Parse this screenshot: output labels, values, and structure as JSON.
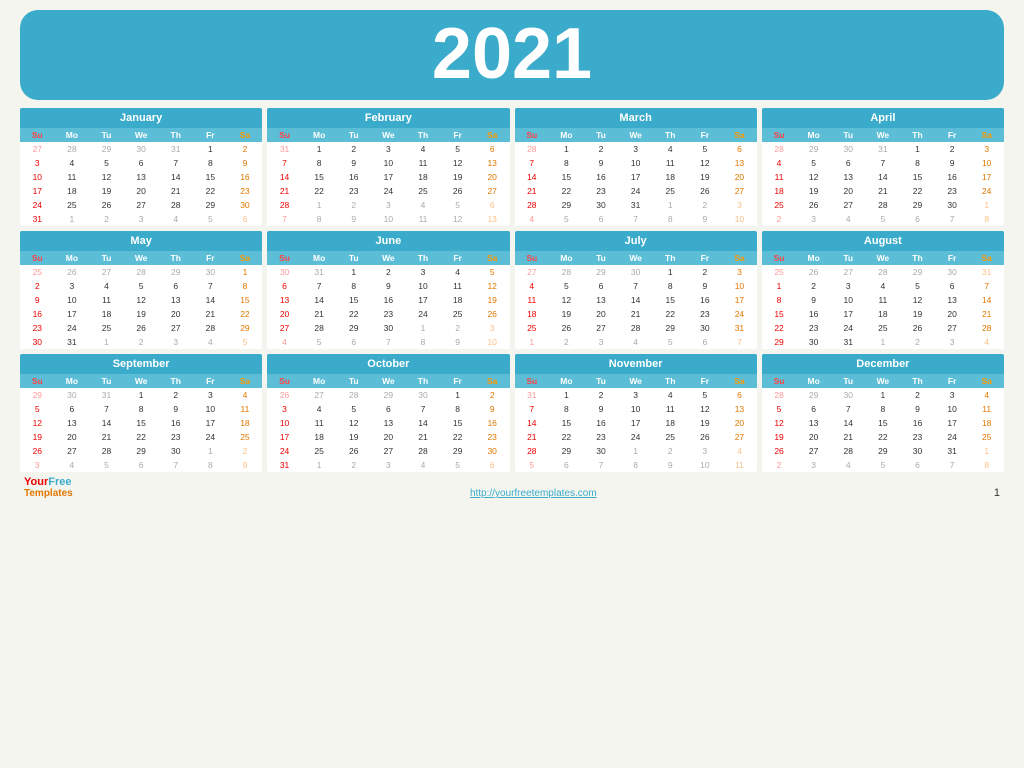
{
  "year": "2021",
  "months": [
    {
      "name": "January",
      "weeks": [
        [
          "27",
          "28",
          "29",
          "30",
          "31",
          "1",
          "2"
        ],
        [
          "3",
          "4",
          "5",
          "6",
          "7",
          "8",
          "9"
        ],
        [
          "10",
          "11",
          "12",
          "13",
          "14",
          "15",
          "16"
        ],
        [
          "17",
          "18",
          "19",
          "20",
          "21",
          "22",
          "23"
        ],
        [
          "24",
          "25",
          "26",
          "27",
          "28",
          "29",
          "30"
        ],
        [
          "31",
          "1",
          "2",
          "3",
          "4",
          "5",
          "6"
        ]
      ],
      "otherMonthCells": [
        [
          0,
          0
        ],
        [
          0,
          1
        ],
        [
          0,
          2
        ],
        [
          0,
          3
        ],
        [
          0,
          4
        ],
        [
          5,
          1
        ],
        [
          5,
          2
        ],
        [
          5,
          3
        ],
        [
          5,
          4
        ],
        [
          5,
          5
        ],
        [
          5,
          6
        ]
      ]
    },
    {
      "name": "February",
      "weeks": [
        [
          "31",
          "1",
          "2",
          "3",
          "4",
          "5",
          "6"
        ],
        [
          "7",
          "8",
          "9",
          "10",
          "11",
          "12",
          "13"
        ],
        [
          "14",
          "15",
          "16",
          "17",
          "18",
          "19",
          "20"
        ],
        [
          "21",
          "22",
          "23",
          "24",
          "25",
          "26",
          "27"
        ],
        [
          "28",
          "1",
          "2",
          "3",
          "4",
          "5",
          "6"
        ],
        [
          "7",
          "8",
          "9",
          "10",
          "11",
          "12",
          "13"
        ]
      ],
      "otherMonthCells": [
        [
          0,
          0
        ],
        [
          4,
          1
        ],
        [
          4,
          2
        ],
        [
          4,
          3
        ],
        [
          4,
          4
        ],
        [
          4,
          5
        ],
        [
          4,
          6
        ],
        [
          5,
          0
        ],
        [
          5,
          1
        ],
        [
          5,
          2
        ],
        [
          5,
          3
        ],
        [
          5,
          4
        ],
        [
          5,
          5
        ],
        [
          5,
          6
        ]
      ]
    },
    {
      "name": "March",
      "weeks": [
        [
          "28",
          "1",
          "2",
          "3",
          "4",
          "5",
          "6"
        ],
        [
          "7",
          "8",
          "9",
          "10",
          "11",
          "12",
          "13"
        ],
        [
          "14",
          "15",
          "16",
          "17",
          "18",
          "19",
          "20"
        ],
        [
          "21",
          "22",
          "23",
          "24",
          "25",
          "26",
          "27"
        ],
        [
          "28",
          "29",
          "30",
          "31",
          "1",
          "2",
          "3"
        ],
        [
          "4",
          "5",
          "6",
          "7",
          "8",
          "9",
          "10"
        ]
      ],
      "otherMonthCells": [
        [
          0,
          0
        ],
        [
          4,
          4
        ],
        [
          4,
          5
        ],
        [
          4,
          6
        ],
        [
          5,
          0
        ],
        [
          5,
          1
        ],
        [
          5,
          2
        ],
        [
          5,
          3
        ],
        [
          5,
          4
        ],
        [
          5,
          5
        ],
        [
          5,
          6
        ]
      ]
    },
    {
      "name": "April",
      "weeks": [
        [
          "28",
          "29",
          "30",
          "31",
          "1",
          "2",
          "3"
        ],
        [
          "4",
          "5",
          "6",
          "7",
          "8",
          "9",
          "10"
        ],
        [
          "11",
          "12",
          "13",
          "14",
          "15",
          "16",
          "17"
        ],
        [
          "18",
          "19",
          "20",
          "21",
          "22",
          "23",
          "24"
        ],
        [
          "25",
          "26",
          "27",
          "28",
          "29",
          "30",
          "1"
        ],
        [
          "2",
          "3",
          "4",
          "5",
          "6",
          "7",
          "8"
        ]
      ],
      "otherMonthCells": [
        [
          0,
          0
        ],
        [
          0,
          1
        ],
        [
          0,
          2
        ],
        [
          0,
          3
        ],
        [
          4,
          6
        ],
        [
          5,
          0
        ],
        [
          5,
          1
        ],
        [
          5,
          2
        ],
        [
          5,
          3
        ],
        [
          5,
          4
        ],
        [
          5,
          5
        ],
        [
          5,
          6
        ]
      ]
    },
    {
      "name": "May",
      "weeks": [
        [
          "25",
          "26",
          "27",
          "28",
          "29",
          "30",
          "1"
        ],
        [
          "2",
          "3",
          "4",
          "5",
          "6",
          "7",
          "8"
        ],
        [
          "9",
          "10",
          "11",
          "12",
          "13",
          "14",
          "15"
        ],
        [
          "16",
          "17",
          "18",
          "19",
          "20",
          "21",
          "22"
        ],
        [
          "23",
          "24",
          "25",
          "26",
          "27",
          "28",
          "29"
        ],
        [
          "30",
          "31",
          "1",
          "2",
          "3",
          "4",
          "5"
        ]
      ],
      "otherMonthCells": [
        [
          0,
          0
        ],
        [
          0,
          1
        ],
        [
          0,
          2
        ],
        [
          0,
          3
        ],
        [
          0,
          4
        ],
        [
          0,
          5
        ],
        [
          5,
          2
        ],
        [
          5,
          3
        ],
        [
          5,
          4
        ],
        [
          5,
          5
        ],
        [
          5,
          6
        ]
      ]
    },
    {
      "name": "June",
      "weeks": [
        [
          "30",
          "31",
          "1",
          "2",
          "3",
          "4",
          "5"
        ],
        [
          "6",
          "7",
          "8",
          "9",
          "10",
          "11",
          "12"
        ],
        [
          "13",
          "14",
          "15",
          "16",
          "17",
          "18",
          "19"
        ],
        [
          "20",
          "21",
          "22",
          "23",
          "24",
          "25",
          "26"
        ],
        [
          "27",
          "28",
          "29",
          "30",
          "1",
          "2",
          "3"
        ],
        [
          "4",
          "5",
          "6",
          "7",
          "8",
          "9",
          "10"
        ]
      ],
      "otherMonthCells": [
        [
          0,
          0
        ],
        [
          0,
          1
        ],
        [
          4,
          4
        ],
        [
          4,
          5
        ],
        [
          4,
          6
        ],
        [
          5,
          0
        ],
        [
          5,
          1
        ],
        [
          5,
          2
        ],
        [
          5,
          3
        ],
        [
          5,
          4
        ],
        [
          5,
          5
        ],
        [
          5,
          6
        ]
      ]
    },
    {
      "name": "July",
      "weeks": [
        [
          "27",
          "28",
          "29",
          "30",
          "1",
          "2",
          "3"
        ],
        [
          "4",
          "5",
          "6",
          "7",
          "8",
          "9",
          "10"
        ],
        [
          "11",
          "12",
          "13",
          "14",
          "15",
          "16",
          "17"
        ],
        [
          "18",
          "19",
          "20",
          "21",
          "22",
          "23",
          "24"
        ],
        [
          "25",
          "26",
          "27",
          "28",
          "29",
          "30",
          "31"
        ],
        [
          "1",
          "2",
          "3",
          "4",
          "5",
          "6",
          "7"
        ]
      ],
      "otherMonthCells": [
        [
          0,
          0
        ],
        [
          0,
          1
        ],
        [
          0,
          2
        ],
        [
          0,
          3
        ],
        [
          5,
          0
        ],
        [
          5,
          1
        ],
        [
          5,
          2
        ],
        [
          5,
          3
        ],
        [
          5,
          4
        ],
        [
          5,
          5
        ],
        [
          5,
          6
        ]
      ]
    },
    {
      "name": "August",
      "weeks": [
        [
          "25",
          "26",
          "27",
          "28",
          "29",
          "30",
          "31"
        ],
        [
          "1",
          "2",
          "3",
          "4",
          "5",
          "6",
          "7"
        ],
        [
          "8",
          "9",
          "10",
          "11",
          "12",
          "13",
          "14"
        ],
        [
          "15",
          "16",
          "17",
          "18",
          "19",
          "20",
          "21"
        ],
        [
          "22",
          "23",
          "24",
          "25",
          "26",
          "27",
          "28"
        ],
        [
          "29",
          "30",
          "31",
          "1",
          "2",
          "3",
          "4"
        ]
      ],
      "otherMonthCells": [
        [
          0,
          0
        ],
        [
          0,
          1
        ],
        [
          0,
          2
        ],
        [
          0,
          3
        ],
        [
          0,
          4
        ],
        [
          0,
          5
        ],
        [
          0,
          6
        ],
        [
          5,
          3
        ],
        [
          5,
          4
        ],
        [
          5,
          5
        ],
        [
          5,
          6
        ]
      ]
    },
    {
      "name": "September",
      "weeks": [
        [
          "29",
          "30",
          "31",
          "1",
          "2",
          "3",
          "4"
        ],
        [
          "5",
          "6",
          "7",
          "8",
          "9",
          "10",
          "11"
        ],
        [
          "12",
          "13",
          "14",
          "15",
          "16",
          "17",
          "18"
        ],
        [
          "19",
          "20",
          "21",
          "22",
          "23",
          "24",
          "25"
        ],
        [
          "26",
          "27",
          "28",
          "29",
          "30",
          "1",
          "2"
        ],
        [
          "3",
          "4",
          "5",
          "6",
          "7",
          "8",
          "9"
        ]
      ],
      "otherMonthCells": [
        [
          0,
          0
        ],
        [
          0,
          1
        ],
        [
          0,
          2
        ],
        [
          4,
          5
        ],
        [
          4,
          6
        ],
        [
          5,
          0
        ],
        [
          5,
          1
        ],
        [
          5,
          2
        ],
        [
          5,
          3
        ],
        [
          5,
          4
        ],
        [
          5,
          5
        ],
        [
          5,
          6
        ]
      ]
    },
    {
      "name": "October",
      "weeks": [
        [
          "26",
          "27",
          "28",
          "29",
          "30",
          "1",
          "2"
        ],
        [
          "3",
          "4",
          "5",
          "6",
          "7",
          "8",
          "9"
        ],
        [
          "10",
          "11",
          "12",
          "13",
          "14",
          "15",
          "16"
        ],
        [
          "17",
          "18",
          "19",
          "20",
          "21",
          "22",
          "23"
        ],
        [
          "24",
          "25",
          "26",
          "27",
          "28",
          "29",
          "30"
        ],
        [
          "31",
          "1",
          "2",
          "3",
          "4",
          "5",
          "6"
        ]
      ],
      "otherMonthCells": [
        [
          0,
          0
        ],
        [
          0,
          1
        ],
        [
          0,
          2
        ],
        [
          0,
          3
        ],
        [
          0,
          4
        ],
        [
          5,
          1
        ],
        [
          5,
          2
        ],
        [
          5,
          3
        ],
        [
          5,
          4
        ],
        [
          5,
          5
        ],
        [
          5,
          6
        ]
      ]
    },
    {
      "name": "November",
      "weeks": [
        [
          "31",
          "1",
          "2",
          "3",
          "4",
          "5",
          "6"
        ],
        [
          "7",
          "8",
          "9",
          "10",
          "11",
          "12",
          "13"
        ],
        [
          "14",
          "15",
          "16",
          "17",
          "18",
          "19",
          "20"
        ],
        [
          "21",
          "22",
          "23",
          "24",
          "25",
          "26",
          "27"
        ],
        [
          "28",
          "29",
          "30",
          "1",
          "2",
          "3",
          "4"
        ],
        [
          "5",
          "6",
          "7",
          "8",
          "9",
          "10",
          "11"
        ]
      ],
      "otherMonthCells": [
        [
          0,
          0
        ],
        [
          4,
          3
        ],
        [
          4,
          4
        ],
        [
          4,
          5
        ],
        [
          4,
          6
        ],
        [
          5,
          0
        ],
        [
          5,
          1
        ],
        [
          5,
          2
        ],
        [
          5,
          3
        ],
        [
          5,
          4
        ],
        [
          5,
          5
        ],
        [
          5,
          6
        ]
      ]
    },
    {
      "name": "December",
      "weeks": [
        [
          "28",
          "29",
          "30",
          "1",
          "2",
          "3",
          "4"
        ],
        [
          "5",
          "6",
          "7",
          "8",
          "9",
          "10",
          "11"
        ],
        [
          "12",
          "13",
          "14",
          "15",
          "16",
          "17",
          "18"
        ],
        [
          "19",
          "20",
          "21",
          "22",
          "23",
          "24",
          "25"
        ],
        [
          "26",
          "27",
          "28",
          "29",
          "30",
          "31",
          "1"
        ],
        [
          "2",
          "3",
          "4",
          "5",
          "6",
          "7",
          "8"
        ]
      ],
      "otherMonthCells": [
        [
          0,
          0
        ],
        [
          0,
          1
        ],
        [
          0,
          2
        ],
        [
          4,
          6
        ],
        [
          5,
          0
        ],
        [
          5,
          1
        ],
        [
          5,
          2
        ],
        [
          5,
          3
        ],
        [
          5,
          4
        ],
        [
          5,
          5
        ],
        [
          5,
          6
        ]
      ]
    }
  ],
  "dayHeaders": [
    "Su",
    "Mo",
    "Tu",
    "We",
    "Th",
    "Fr",
    "Sa"
  ],
  "footer": {
    "url": "http://yourfreetemplates.com",
    "page": "1",
    "logo_your": "Your",
    "logo_free": "Free",
    "logo_templates": "Templates"
  }
}
